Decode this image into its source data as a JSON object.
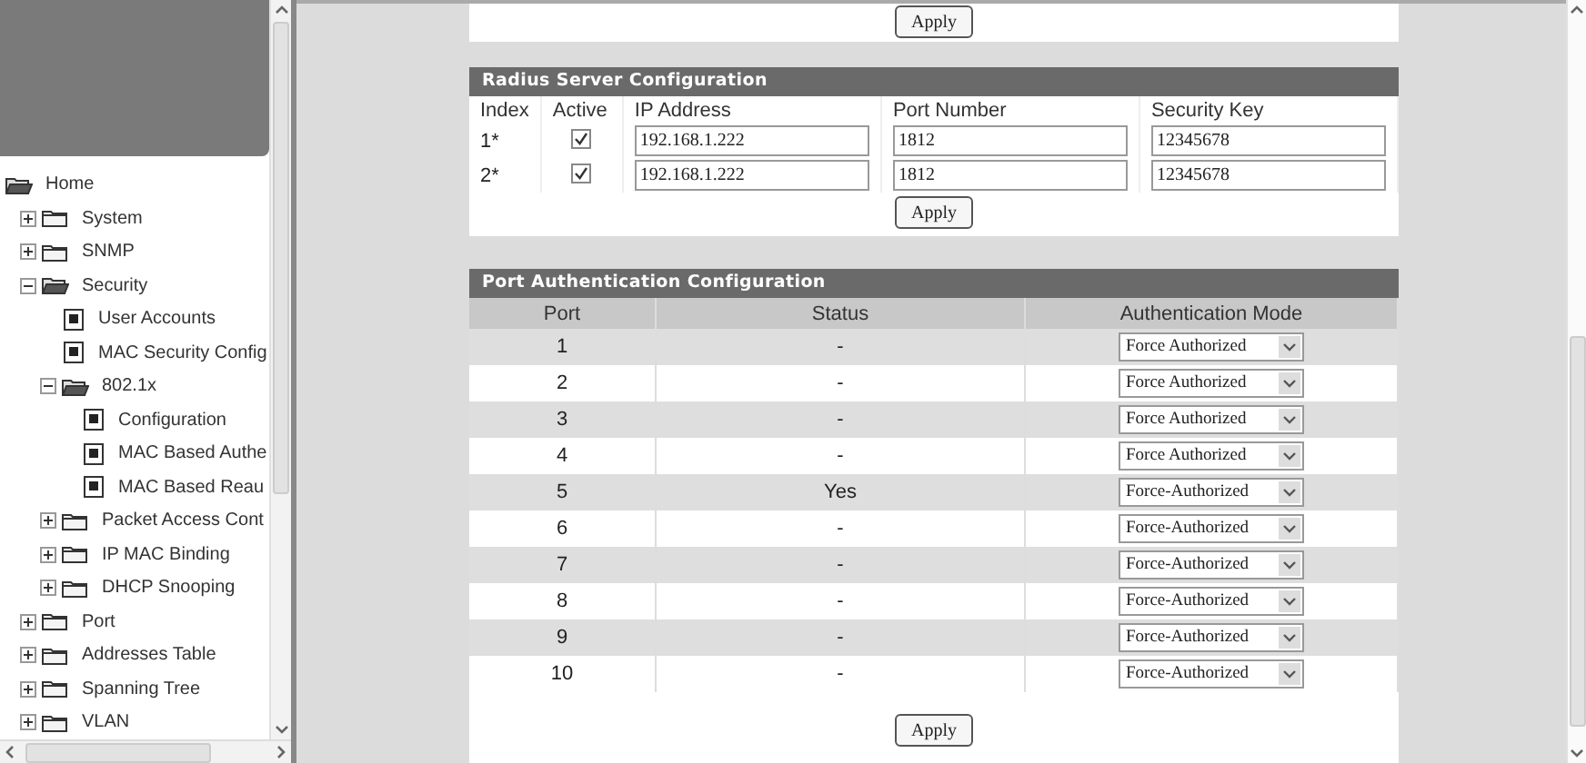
{
  "sidebar": {
    "tree": [
      {
        "label": "Home",
        "kind": "folder",
        "expanded": true,
        "children": [
          {
            "label": "System",
            "kind": "folder",
            "expanded": false
          },
          {
            "label": "SNMP",
            "kind": "folder",
            "expanded": false
          },
          {
            "label": "Security",
            "kind": "folder",
            "expanded": true,
            "children": [
              {
                "label": "User Accounts",
                "kind": "page"
              },
              {
                "label": "MAC Security Config",
                "kind": "page"
              },
              {
                "label": "802.1x",
                "kind": "folder",
                "expanded": true,
                "children": [
                  {
                    "label": "Configuration",
                    "kind": "page"
                  },
                  {
                    "label": "MAC Based Authe",
                    "kind": "page"
                  },
                  {
                    "label": "MAC Based Reau",
                    "kind": "page"
                  }
                ]
              },
              {
                "label": "Packet Access Cont",
                "kind": "folder",
                "expanded": false
              },
              {
                "label": "IP MAC Binding",
                "kind": "folder",
                "expanded": false
              },
              {
                "label": "DHCP Snooping",
                "kind": "folder",
                "expanded": false
              }
            ]
          },
          {
            "label": "Port",
            "kind": "folder",
            "expanded": false
          },
          {
            "label": "Addresses Table",
            "kind": "folder",
            "expanded": false
          },
          {
            "label": "Spanning Tree",
            "kind": "folder",
            "expanded": false
          },
          {
            "label": "VLAN",
            "kind": "folder",
            "expanded": false
          }
        ]
      }
    ]
  },
  "main": {
    "top_panel": {
      "button": "Apply"
    },
    "radius": {
      "title": "Radius Server Configuration",
      "columns": [
        "Index",
        "Active",
        "IP Address",
        "Port Number",
        "Security Key"
      ],
      "rows": [
        {
          "index": "1*",
          "active": true,
          "ip_address": "192.168.1.222",
          "port_number": "1812",
          "security_key": "12345678"
        },
        {
          "index": "2*",
          "active": true,
          "ip_address": "192.168.1.222",
          "port_number": "1812",
          "security_key": "12345678"
        }
      ],
      "button": "Apply"
    },
    "port_auth": {
      "title": "Port Authentication Configuration",
      "columns": [
        "Port",
        "Status",
        "Authentication Mode"
      ],
      "rows": [
        {
          "port": "1",
          "status": "-",
          "mode": "Force Authorized"
        },
        {
          "port": "2",
          "status": "-",
          "mode": "Force Authorized"
        },
        {
          "port": "3",
          "status": "-",
          "mode": "Force Authorized"
        },
        {
          "port": "4",
          "status": "-",
          "mode": "Force Authorized"
        },
        {
          "port": "5",
          "status": "Yes",
          "mode": "Force-Authorized"
        },
        {
          "port": "6",
          "status": "-",
          "mode": "Force-Authorized"
        },
        {
          "port": "7",
          "status": "-",
          "mode": "Force-Authorized"
        },
        {
          "port": "8",
          "status": "-",
          "mode": "Force-Authorized"
        },
        {
          "port": "9",
          "status": "-",
          "mode": "Force-Authorized"
        },
        {
          "port": "10",
          "status": "-",
          "mode": "Force-Authorized"
        }
      ],
      "button": "Apply"
    }
  }
}
